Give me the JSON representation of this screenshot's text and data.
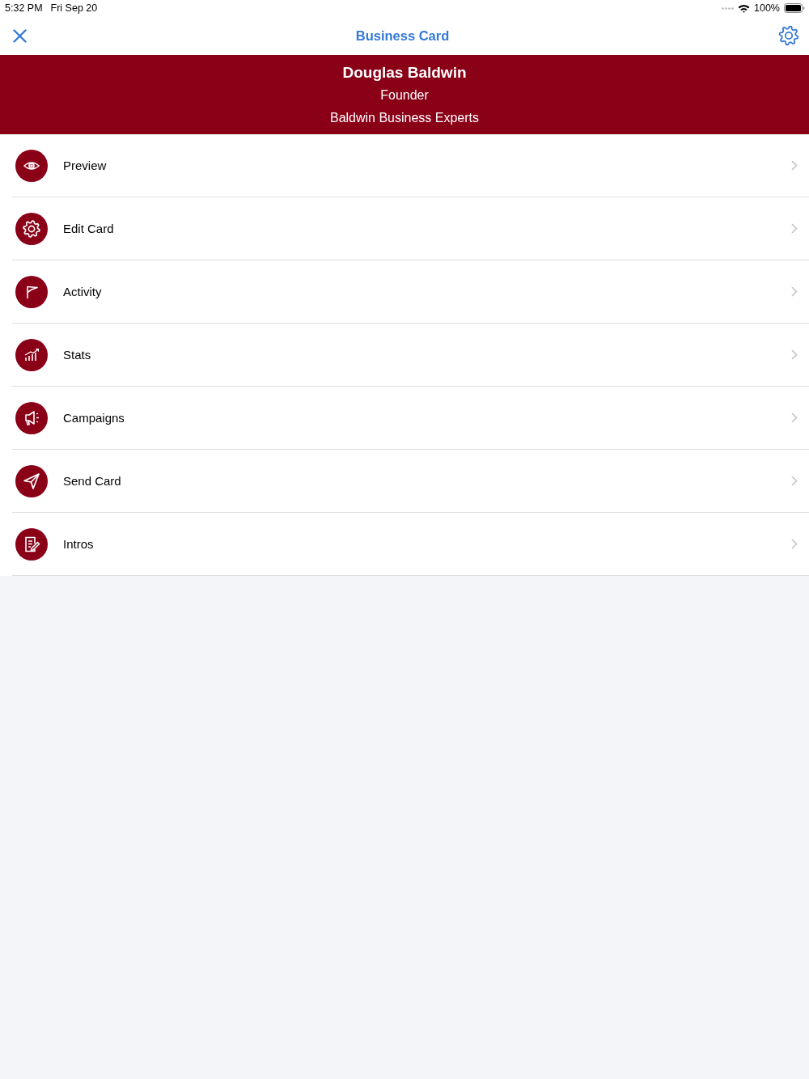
{
  "status_bar": {
    "time": "5:32 PM",
    "date": "Fri Sep 20",
    "battery": "100%"
  },
  "nav_bar": {
    "title": "Business Card"
  },
  "profile": {
    "name": "Douglas Baldwin",
    "title": "Founder",
    "company": "Baldwin Business Experts"
  },
  "menu": [
    {
      "label": "Preview"
    },
    {
      "label": "Edit Card"
    },
    {
      "label": "Activity"
    },
    {
      "label": "Stats"
    },
    {
      "label": "Campaigns"
    },
    {
      "label": "Send Card"
    },
    {
      "label": "Intros"
    }
  ]
}
